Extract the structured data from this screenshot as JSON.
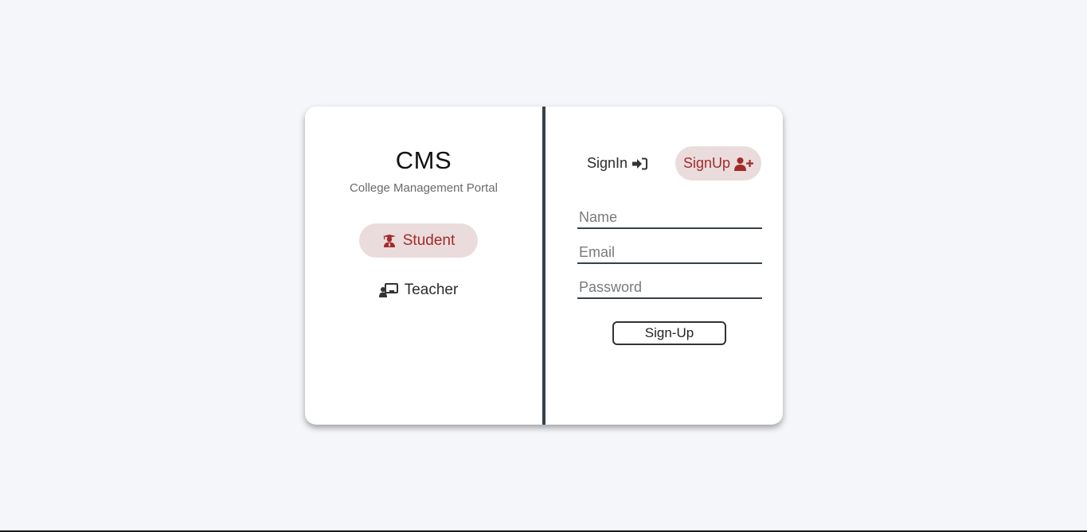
{
  "brand": {
    "title": "CMS",
    "subtitle": "College Management Portal"
  },
  "roles": [
    {
      "label": "Student",
      "icon": "student-graduate-icon",
      "selected": true
    },
    {
      "label": "Teacher",
      "icon": "teacher-board-icon",
      "selected": false
    }
  ],
  "auth_tabs": {
    "signin": {
      "label": "SignIn",
      "icon": "sign-in-icon",
      "selected": false
    },
    "signup": {
      "label": "SignUp",
      "icon": "user-plus-icon",
      "selected": true
    }
  },
  "form": {
    "name_placeholder": "Name",
    "email_placeholder": "Email",
    "password_placeholder": "Password",
    "submit_label": "Sign-Up"
  },
  "colors": {
    "accent": "#a52a2a",
    "accent_bg": "#eadcdc",
    "divider": "#36414a",
    "page_bg": "#f5f6fa"
  }
}
